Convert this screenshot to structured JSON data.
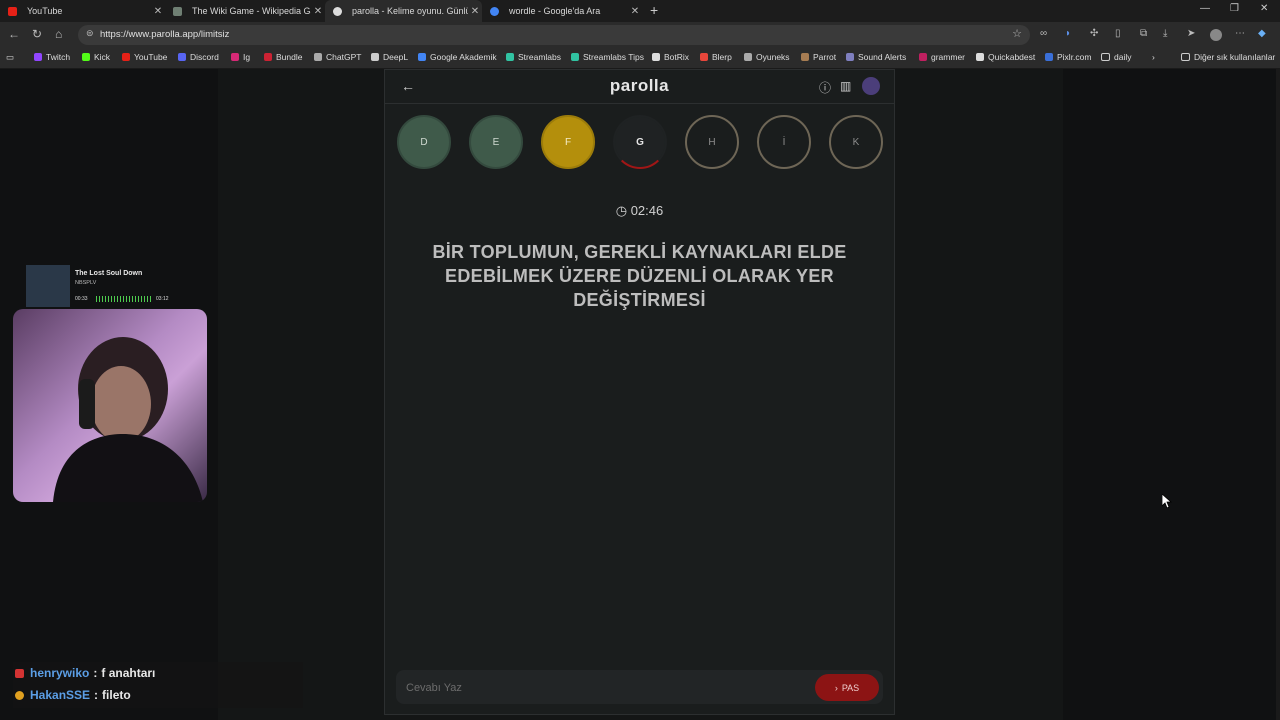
{
  "browser": {
    "tabs": [
      {
        "title": "YouTube",
        "fav_color": "#e62117"
      },
      {
        "title": "The Wiki Game - Wikipedia Game",
        "fav_color": "#6f7f73"
      },
      {
        "title": "parolla - Kelime oyunu. Günlük ke",
        "fav_color": "#dddddd"
      },
      {
        "title": "wordle - Google'da Ara",
        "fav_color": "#4285f4"
      }
    ],
    "url": "https://www.parolla.app/limitsiz",
    "bookmarks": [
      {
        "label": "Twitch",
        "color": "#9146ff"
      },
      {
        "label": "Kick",
        "color": "#53fc18"
      },
      {
        "label": "YouTube",
        "color": "#e62117"
      },
      {
        "label": "Discord",
        "color": "#5865f2"
      },
      {
        "label": "Ig",
        "color": "#d62976"
      },
      {
        "label": "Bundle",
        "color": "#cc2233"
      },
      {
        "label": "ChatGPT",
        "color": "#aaaaaa"
      },
      {
        "label": "DeepL",
        "color": "#cccccc"
      },
      {
        "label": "Google Akademik",
        "color": "#4285f4"
      },
      {
        "label": "Streamlabs",
        "color": "#31c3a2"
      },
      {
        "label": "Streamlabs Tips",
        "color": "#31c3a2"
      },
      {
        "label": "BotRix",
        "color": "#dddddd"
      },
      {
        "label": "Blerp",
        "color": "#e8463b"
      },
      {
        "label": "Oyuneks",
        "color": "#aaaaaa"
      },
      {
        "label": "Parrot",
        "color": "#a67c52"
      },
      {
        "label": "Sound Alerts",
        "color": "#7f7fbf"
      },
      {
        "label": "grammer",
        "color": "#c02060"
      },
      {
        "label": "Quickabdest",
        "color": "#dddddd"
      },
      {
        "label": "Pixlr.com",
        "color": "#3a6fd8"
      },
      {
        "label": "daily",
        "color": "#cccccc"
      }
    ],
    "other_bookmarks": "Diğer sık kullanılanlar"
  },
  "app": {
    "logo": "parolla",
    "letters": [
      {
        "letter": "D",
        "state": "done"
      },
      {
        "letter": "E",
        "state": "done"
      },
      {
        "letter": "F",
        "state": "pass"
      },
      {
        "letter": "G",
        "state": "current"
      },
      {
        "letter": "H",
        "state": "todo"
      },
      {
        "letter": "İ",
        "state": "todo"
      },
      {
        "letter": "K",
        "state": "todo"
      }
    ],
    "timer": "02:46",
    "question": "BİR TOPLUMUN, GEREKLİ KAYNAKLARI ELDE EDEBİLMEK ÜZERE DÜZENLİ OLARAK YER DEĞİŞTİRMESİ",
    "answer_placeholder": "Cevabı Yaz",
    "answer_value": "",
    "pass_label": "PAS"
  },
  "music": {
    "title": "The Lost Soul Down",
    "artist": "NBSPLV",
    "elapsed": "00:33",
    "duration": "03:12",
    "progress": 0.18
  },
  "chat": [
    {
      "user": "henrywiko",
      "text": "f anahtarı",
      "badge_color": "#d33333"
    },
    {
      "user": "HakanSSE",
      "text": "fileto",
      "badge_color": "#e0a020"
    }
  ]
}
